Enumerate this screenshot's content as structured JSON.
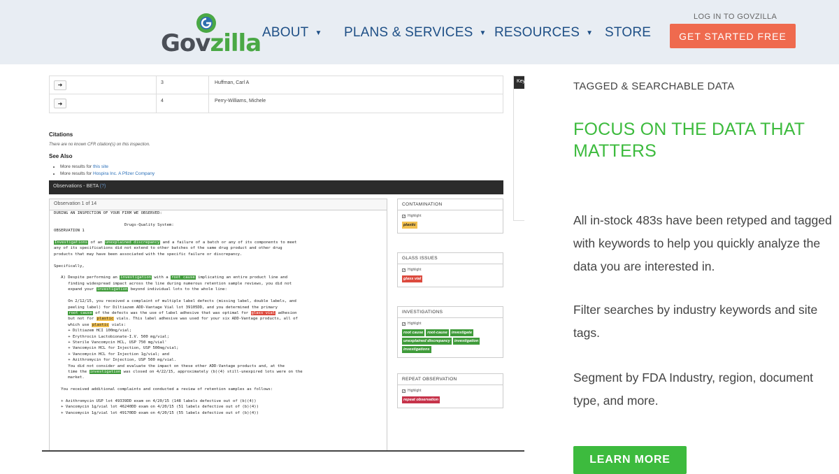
{
  "header": {
    "logo_text_a": "Gov",
    "logo_text_b": "zilla",
    "logo_icon": "green-g-icon",
    "nav": [
      {
        "label": "ABOUT",
        "dropdown": true
      },
      {
        "label": "PLANS & SERVICES",
        "dropdown": true
      },
      {
        "label": "RESOURCES",
        "dropdown": true
      },
      {
        "label": "STORE",
        "dropdown": false
      }
    ],
    "login": "LOG IN TO GOVZILLA",
    "cta": "GET STARTED FREE"
  },
  "screenshot": {
    "rows": [
      {
        "num": "3",
        "name": "Huffman, Carl A"
      },
      {
        "num": "4",
        "name": "Perry-Williams, Michele"
      }
    ],
    "side_header": "Key",
    "citations_title": "Citations",
    "citations_text": "There are no known CFR citation(s) on this inspection.",
    "see_also_title": "See Also",
    "see_also": [
      {
        "prefix": "More results for ",
        "link": "this site"
      },
      {
        "prefix": "More results for ",
        "link": "Hospira Inc. A Pfizer Company"
      }
    ],
    "obs_bar": "Observations - BETA",
    "obs_bar_suffix": "(?)",
    "obs_header": "Observation 1 of 14",
    "tag_panels": [
      {
        "title": "CONTAMINATION",
        "check": "Highlight",
        "tags": [
          {
            "t": "plastic",
            "c": "y"
          }
        ]
      },
      {
        "title": "GLASS ISSUES",
        "check": "Highlight",
        "tags": [
          {
            "t": "glass vial",
            "c": "r"
          }
        ]
      },
      {
        "title": "INVESTIGATIONS",
        "check": "Highlight",
        "tags": [
          {
            "t": "root cause",
            "c": "g"
          },
          {
            "t": "root-cause",
            "c": "g"
          },
          {
            "t": "investigate",
            "c": "g"
          },
          {
            "t": "unexplained discrepancy",
            "c": "g"
          },
          {
            "t": "investigation",
            "c": "g"
          },
          {
            "t": "investigations",
            "c": "g"
          }
        ]
      },
      {
        "title": "REPEAT OBSERVATION",
        "check": "Highlight",
        "tags": [
          {
            "t": "repeat observation",
            "c": "m"
          }
        ]
      }
    ]
  },
  "copy": {
    "eyebrow": "TAGGED & SEARCHABLE DATA",
    "headline": "FOCUS ON THE DATA THAT MATTERS",
    "p1": "All in-stock 483s have been retyped and tagged with keywords to help you quickly analyze the data you are interested in.",
    "p2": "Filter searches by industry keywords and site tags.",
    "p3": "Segment by FDA Industry, region, document type, and more.",
    "button": "LEARN MORE"
  },
  "colors": {
    "header_bg": "#e8edf3",
    "nav_text": "#1e4f86",
    "cta_bg": "#ef6a4e",
    "accent_green": "#3dbb3e"
  }
}
